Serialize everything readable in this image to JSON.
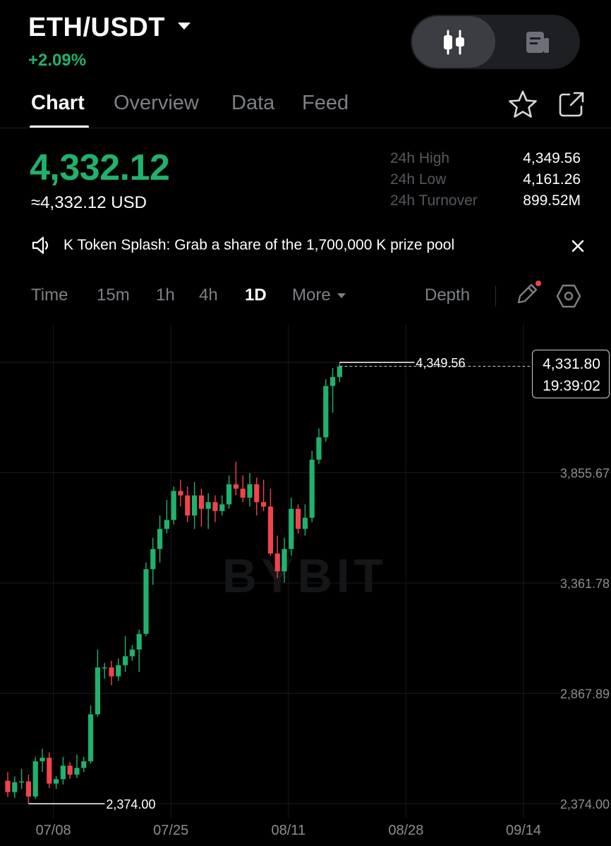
{
  "header": {
    "pair": "ETH/USDT",
    "change": "+2.09%",
    "view_toggle": {
      "active": "candlestick-icon",
      "inactive": "article-icon"
    }
  },
  "tabs": [
    {
      "label": "Chart",
      "active": true
    },
    {
      "label": "Overview",
      "active": false
    },
    {
      "label": "Data",
      "active": false
    },
    {
      "label": "Feed",
      "active": false
    }
  ],
  "price": {
    "last": "4,332.12",
    "usd": "≈4,332.12 USD",
    "stats": [
      {
        "label": "24h High",
        "value": "4,349.56"
      },
      {
        "label": "24h Low",
        "value": "4,161.26"
      },
      {
        "label": "24h Turnover",
        "value": "899.52M"
      }
    ]
  },
  "banner": {
    "text": "K Token Splash: Grab a share of the 1,700,000 K prize pool",
    "icon": "speaker-icon"
  },
  "intervals": {
    "items": [
      "Time",
      "15m",
      "1h",
      "4h",
      "1D"
    ],
    "active": "1D",
    "more": "More",
    "depth": "Depth"
  },
  "colors": {
    "up": "#20b26c",
    "down": "#ef454a",
    "background": "#000000"
  },
  "chart_data": {
    "type": "candlestick",
    "interval": "1D",
    "watermark": "BYBIT",
    "y_ticks": [
      "3,855.67",
      "3,361.78",
      "2,867.89",
      "2,374.00"
    ],
    "x_ticks": [
      "07/08",
      "07/25",
      "08/11",
      "08/28",
      "09/14"
    ],
    "ylim": [
      2374.0,
      4349.56
    ],
    "high_marker": "4,349.56",
    "low_marker": "2,374.00",
    "last_price_label": "4,331.80",
    "countdown_label": "19:39:02",
    "start_date": "07/01",
    "candles": [
      {
        "date": "07/01",
        "o": 2477,
        "h": 2515,
        "l": 2404,
        "c": 2426
      },
      {
        "date": "07/02",
        "o": 2426,
        "h": 2496,
        "l": 2400,
        "c": 2470
      },
      {
        "date": "07/03",
        "o": 2470,
        "h": 2530,
        "l": 2440,
        "c": 2474
      },
      {
        "date": "07/04",
        "o": 2474,
        "h": 2504,
        "l": 2376,
        "c": 2406
      },
      {
        "date": "07/05",
        "o": 2406,
        "h": 2584,
        "l": 2396,
        "c": 2564
      },
      {
        "date": "07/06",
        "o": 2564,
        "h": 2620,
        "l": 2516,
        "c": 2580
      },
      {
        "date": "07/07",
        "o": 2580,
        "h": 2604,
        "l": 2444,
        "c": 2464
      },
      {
        "date": "07/08",
        "o": 2464,
        "h": 2498,
        "l": 2440,
        "c": 2484
      },
      {
        "date": "07/09",
        "o": 2484,
        "h": 2584,
        "l": 2460,
        "c": 2544
      },
      {
        "date": "07/10",
        "o": 2544,
        "h": 2560,
        "l": 2486,
        "c": 2504
      },
      {
        "date": "07/11",
        "o": 2504,
        "h": 2594,
        "l": 2488,
        "c": 2534
      },
      {
        "date": "07/12",
        "o": 2534,
        "h": 2584,
        "l": 2516,
        "c": 2564
      },
      {
        "date": "07/13",
        "o": 2564,
        "h": 2814,
        "l": 2554,
        "c": 2774
      },
      {
        "date": "07/14",
        "o": 2774,
        "h": 3064,
        "l": 2764,
        "c": 2984
      },
      {
        "date": "07/15",
        "o": 2984,
        "h": 3004,
        "l": 2934,
        "c": 2984
      },
      {
        "date": "07/16",
        "o": 2984,
        "h": 3014,
        "l": 2904,
        "c": 2944
      },
      {
        "date": "07/17",
        "o": 2944,
        "h": 3024,
        "l": 2924,
        "c": 2994
      },
      {
        "date": "07/18",
        "o": 2994,
        "h": 3124,
        "l": 2964,
        "c": 3034
      },
      {
        "date": "07/19",
        "o": 3034,
        "h": 3084,
        "l": 3014,
        "c": 3064
      },
      {
        "date": "07/20",
        "o": 3064,
        "h": 3154,
        "l": 2964,
        "c": 3134
      },
      {
        "date": "07/21",
        "o": 3134,
        "h": 3454,
        "l": 3124,
        "c": 3424
      },
      {
        "date": "07/22",
        "o": 3424,
        "h": 3564,
        "l": 3354,
        "c": 3514
      },
      {
        "date": "07/23",
        "o": 3514,
        "h": 3664,
        "l": 3454,
        "c": 3604
      },
      {
        "date": "07/24",
        "o": 3604,
        "h": 3734,
        "l": 3584,
        "c": 3644
      },
      {
        "date": "07/25",
        "o": 3644,
        "h": 3794,
        "l": 3624,
        "c": 3774
      },
      {
        "date": "07/26",
        "o": 3774,
        "h": 3824,
        "l": 3704,
        "c": 3754
      },
      {
        "date": "07/27",
        "o": 3754,
        "h": 3794,
        "l": 3634,
        "c": 3664
      },
      {
        "date": "07/28",
        "o": 3664,
        "h": 3814,
        "l": 3604,
        "c": 3754
      },
      {
        "date": "07/29",
        "o": 3754,
        "h": 3784,
        "l": 3614,
        "c": 3694
      },
      {
        "date": "07/30",
        "o": 3694,
        "h": 3764,
        "l": 3604,
        "c": 3724
      },
      {
        "date": "07/31",
        "o": 3724,
        "h": 3754,
        "l": 3634,
        "c": 3684
      },
      {
        "date": "08/01",
        "o": 3684,
        "h": 3754,
        "l": 3664,
        "c": 3714
      },
      {
        "date": "08/02",
        "o": 3714,
        "h": 3844,
        "l": 3694,
        "c": 3804
      },
      {
        "date": "08/03",
        "o": 3804,
        "h": 3904,
        "l": 3754,
        "c": 3784
      },
      {
        "date": "08/04",
        "o": 3784,
        "h": 3844,
        "l": 3724,
        "c": 3744
      },
      {
        "date": "08/05",
        "o": 3744,
        "h": 3854,
        "l": 3704,
        "c": 3804
      },
      {
        "date": "08/06",
        "o": 3804,
        "h": 3834,
        "l": 3664,
        "c": 3724
      },
      {
        "date": "08/07",
        "o": 3724,
        "h": 3824,
        "l": 3684,
        "c": 3704
      },
      {
        "date": "08/08",
        "o": 3704,
        "h": 3784,
        "l": 3484,
        "c": 3494
      },
      {
        "date": "08/09",
        "o": 3494,
        "h": 3574,
        "l": 3384,
        "c": 3414
      },
      {
        "date": "08/10",
        "o": 3414,
        "h": 3564,
        "l": 3364,
        "c": 3514
      },
      {
        "date": "08/11",
        "o": 3514,
        "h": 3744,
        "l": 3484,
        "c": 3694
      },
      {
        "date": "08/12",
        "o": 3694,
        "h": 3714,
        "l": 3584,
        "c": 3604
      },
      {
        "date": "08/13",
        "o": 3604,
        "h": 3714,
        "l": 3574,
        "c": 3654
      },
      {
        "date": "08/14",
        "o": 3654,
        "h": 3954,
        "l": 3634,
        "c": 3914
      },
      {
        "date": "08/15",
        "o": 3914,
        "h": 4054,
        "l": 3894,
        "c": 4014
      },
      {
        "date": "08/16",
        "o": 4014,
        "h": 4274,
        "l": 3994,
        "c": 4244
      },
      {
        "date": "08/17",
        "o": 4244,
        "h": 4324,
        "l": 4124,
        "c": 4284
      },
      {
        "date": "08/18",
        "o": 4284,
        "h": 4349.56,
        "l": 4261,
        "c": 4331.8
      }
    ]
  }
}
